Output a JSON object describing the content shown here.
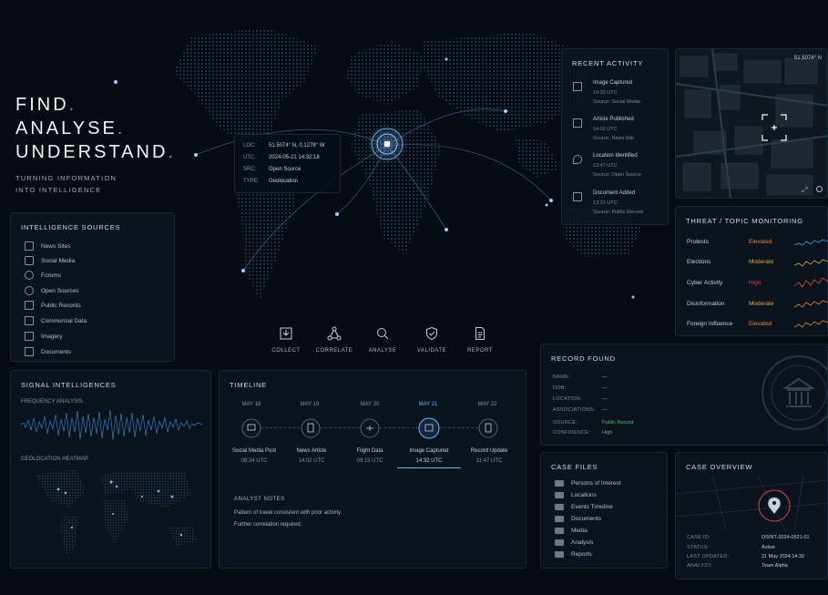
{
  "hero": {
    "line1": "FIND",
    "line2": "ANALYSE",
    "line3": "UNDERSTAND",
    "dot": ".",
    "subtitle1": "TURNING INFORMATION",
    "subtitle2": "INTO INTELLIGENCE"
  },
  "map_popup": {
    "loc_label": "LOC:",
    "loc_value": "51.5074° N, 0.1278° W",
    "utc_label": "UTC:",
    "utc_value": "2024-05-21 14:32:18",
    "src_label": "SRC:",
    "src_value": "Open Source",
    "type_label": "TYPE:",
    "type_value": "Geolocation"
  },
  "workflow": [
    {
      "label": "COLLECT",
      "icon": "download-icon"
    },
    {
      "label": "CORRELATE",
      "icon": "network-icon"
    },
    {
      "label": "ANALYSE",
      "icon": "search-icon"
    },
    {
      "label": "VALIDATE",
      "icon": "shield-check-icon"
    },
    {
      "label": "REPORT",
      "icon": "document-icon"
    }
  ],
  "sources": {
    "title": "INTELLIGENCE SOURCES",
    "items": [
      "News Sites",
      "Social Media",
      "Forums",
      "Open Sources",
      "Public Records",
      "Commercial Data",
      "Imagery",
      "Documents"
    ]
  },
  "signal": {
    "title": "SIGNAL INTELLIGENCES",
    "freq_label": "FREQUENCY ANALYSIS",
    "geo_label": "GEOLOCATION HEATMAP"
  },
  "timeline": {
    "title": "TIMELINE",
    "dates": [
      "MAY 18",
      "MAY 19",
      "MAY 20",
      "MAY 21",
      "MAY 22"
    ],
    "events": [
      {
        "name": "Social Media Post",
        "time": "08:24 UTC"
      },
      {
        "name": "News Article",
        "time": "14:02 UTC"
      },
      {
        "name": "Flight Data",
        "time": "09:15 UTC"
      },
      {
        "name": "Image Captured",
        "time": "14:32 UTC"
      },
      {
        "name": "Record Update",
        "time": "11:47 UTC"
      }
    ],
    "notes_title": "ANALYST NOTES",
    "notes_line1": "Pattern of travel consistent with prior activity.",
    "notes_line2": "Further correlation required."
  },
  "activity": {
    "title": "RECENT ACTIVITY",
    "items": [
      {
        "title": "Image Captured",
        "time": "14:32 UTC",
        "source": "Source: Social Media"
      },
      {
        "title": "Article Published",
        "time": "14:02 UTC",
        "source": "Source: News Site"
      },
      {
        "title": "Location Identified",
        "time": "13:47 UTC",
        "source": "Source: Open Source"
      },
      {
        "title": "Document Added",
        "time": "13:21 UTC",
        "source": "Source: Public Record"
      }
    ]
  },
  "satellite": {
    "coord": "51.5074° N"
  },
  "threat": {
    "title": "THREAT / TOPIC MONITORING",
    "rows": [
      {
        "topic": "Protests",
        "level": "Elevated",
        "color": "#e8862f"
      },
      {
        "topic": "Elections",
        "level": "Moderate",
        "color": "#d9b23a"
      },
      {
        "topic": "Cyber Activity",
        "level": "High",
        "color": "#e0463c"
      },
      {
        "topic": "Disinformation",
        "level": "Moderate",
        "color": "#d9b23a"
      },
      {
        "topic": "Foreign Influence",
        "level": "Elevated",
        "color": "#e8862f"
      }
    ]
  },
  "record": {
    "title": "RECORD FOUND",
    "name_label": "NAME:",
    "name_value": "---",
    "dob_label": "DOB:",
    "dob_value": "---",
    "location_label": "LOCATION:",
    "location_value": "---",
    "assoc_label": "ASSOCIATIONS:",
    "assoc_value": "---",
    "source_label": "SOURCE:",
    "source_value": "Public Record",
    "conf_label": "CONFIDENCE:",
    "conf_value": "High"
  },
  "cases": {
    "title": "CASE FILES",
    "items": [
      "Persons of Interest",
      "Locations",
      "Events Timeline",
      "Documents",
      "Media",
      "Analysis",
      "Reports"
    ]
  },
  "overview": {
    "title": "CASE OVERVIEW",
    "id_label": "CASE ID:",
    "id_value": "OSINT-2024-0521-01",
    "status_label": "STATUS:",
    "status_value": "Active",
    "updated_label": "LAST UPDATED:",
    "updated_value": "21 May 2024 14:32",
    "analyst_label": "ANALYST:",
    "analyst_value": "Team Alpha"
  },
  "colors": {
    "accent": "#3a9bff",
    "bg": "#070c13",
    "panel": "#0d1620",
    "high": "#e0463c",
    "moderate": "#d9b23a",
    "elevated": "#e8862f",
    "ok": "#4cc26a"
  }
}
